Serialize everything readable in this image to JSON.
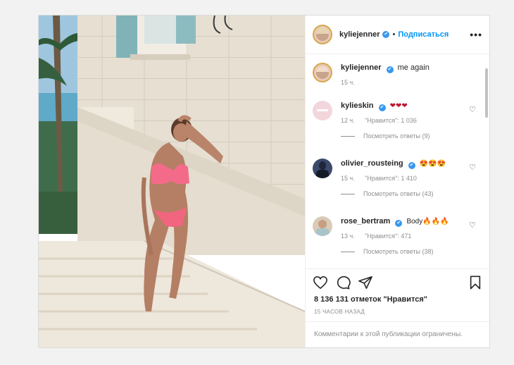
{
  "post": {
    "author": "kyliejenner",
    "follow_label": "Подписаться",
    "separator": "•",
    "more_label": "•••",
    "verified_mark": "✔",
    "caption": {
      "user": "kyliejenner",
      "text": "me again",
      "time": "15 ч."
    },
    "comments": [
      {
        "user": "kylieskin",
        "text": "❤❤❤",
        "time": "12 ч.",
        "likes": "\"Нравится\": 1 036",
        "replies": "Посмотреть ответы (9)"
      },
      {
        "user": "olivier_rousteing",
        "text": "😍😍😍",
        "time": "15 ч.",
        "likes": "\"Нравится\": 1 410",
        "replies": "Посмотреть ответы (43)"
      },
      {
        "user": "rose_bertram",
        "text": "Body🔥🔥🔥",
        "time": "13 ч.",
        "likes": "\"Нравится\": 471",
        "replies": "Посмотреть ответы (38)"
      }
    ],
    "like_count": "8 136 131 отметок \"Нравится\"",
    "posted_ago": "15 ЧАСОВ НАЗАД",
    "comments_limited": "Комментарии к этой публикации ограничены."
  },
  "icons": {
    "like": "heart-icon",
    "comment": "comment-icon",
    "share": "send-icon",
    "save": "bookmark-icon",
    "comment_like": "small-heart-icon"
  },
  "colors": {
    "link": "#0095f6",
    "verified": "#3897f0",
    "muted": "#8e8e8e",
    "border": "#dbdbdb"
  }
}
